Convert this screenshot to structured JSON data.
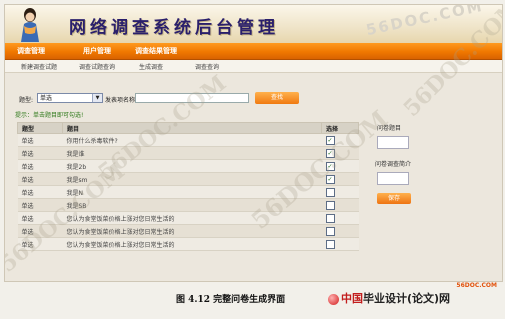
{
  "header": {
    "title": "网络调查系统后台管理"
  },
  "nav": {
    "items": [
      {
        "label": "调查管理"
      },
      {
        "label": "用户管理"
      },
      {
        "label": "调查结果管理"
      }
    ]
  },
  "subnav": {
    "items": [
      {
        "label": "新建调查试题"
      },
      {
        "label": "调查试题查询"
      },
      {
        "label": "生成调查"
      },
      {
        "label": "调查查询"
      }
    ]
  },
  "search": {
    "type_label": "题型:",
    "type_value": "单选",
    "name_label": "发表项名称:",
    "button_label": "查找"
  },
  "tip": "提示：单击题目即可勾选!",
  "table": {
    "headers": [
      "题型",
      "题目",
      "选择"
    ],
    "rows": [
      {
        "type": "单选",
        "question": "你用什么杀毒软件?",
        "checked": true
      },
      {
        "type": "单选",
        "question": "我是谁",
        "checked": true
      },
      {
        "type": "单选",
        "question": "我是2b",
        "checked": true
      },
      {
        "type": "单选",
        "question": "我是sm",
        "checked": true
      },
      {
        "type": "单选",
        "question": "我是N",
        "checked": false
      },
      {
        "type": "单选",
        "question": "我是SB",
        "checked": false
      },
      {
        "type": "单选",
        "question": "您认为食堂饭菜价格上涨对您日常生活的",
        "checked": false
      },
      {
        "type": "单选",
        "question": "您认为食堂饭菜价格上涨对您日常生活的",
        "checked": false
      },
      {
        "type": "单选",
        "question": "您认为食堂饭菜价格上涨对您日常生活的",
        "checked": false
      }
    ]
  },
  "side": {
    "title_label": "问卷题目",
    "intro_label": "问卷调查简介",
    "generate_label": "保存"
  },
  "watermark": {
    "text": "56DOC.COM",
    "corner": "56DOC.COM"
  },
  "caption": "图 4.12 完整问卷生成界面",
  "brand": {
    "prefix": "中国",
    "main": "毕业设计(论文)网"
  }
}
